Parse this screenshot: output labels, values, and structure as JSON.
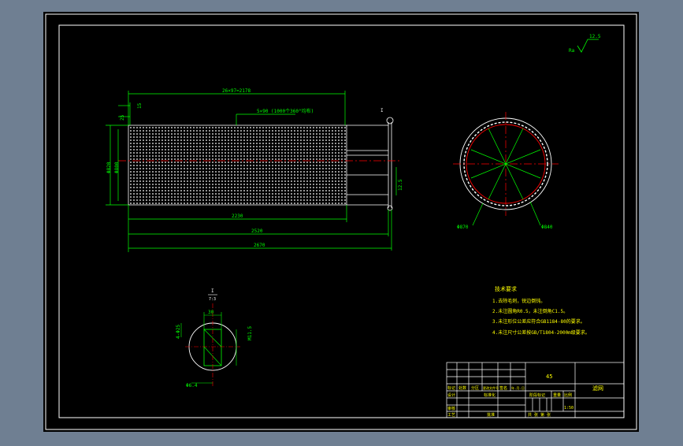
{
  "colors": {
    "background": "#6f7f92",
    "sheet": "#000000",
    "frame": "#ffffff",
    "dimension": "#00ff00",
    "centerline": "#ff0000",
    "note_text": "#ffff00"
  },
  "roughness": {
    "label": "Ra",
    "value": "12.5"
  },
  "main_view": {
    "dims": {
      "top_pattern": "26×97=2178",
      "pitch": "5×90 (1000个360°均布)",
      "left_a": "25",
      "left_b": "15",
      "outer_dia": "Φ820",
      "inner_dia": "Φ800",
      "len_perforated": "2230",
      "len_mid": "2520",
      "len_total": "2670",
      "end_thk": "12.5",
      "section_label": "I"
    }
  },
  "end_view": {
    "dims": {
      "left": "Φ870",
      "right": "Φ840"
    }
  },
  "detail_view": {
    "label": "I",
    "scale": "7:3",
    "dims": {
      "top": "30",
      "left": "4-Φ25",
      "right": "M11.5",
      "bottom": "Φ6.4"
    }
  },
  "tech_notes": {
    "title": "技术要求",
    "items": [
      "1.去除毛刺，锐边倒钝。",
      "2.未注圆角R0.5，未注倒角C1.5。",
      "3.未注形位公差应符合GB1184-80的要求。",
      "4.未注尺寸公差按GB/T1804-2000m级要求。"
    ]
  },
  "title_block": {
    "material": "45",
    "drawing_name": "滤网",
    "row_labels": [
      "标记",
      "处数",
      "分区",
      "更改文件号",
      "签名",
      "年.月.日"
    ],
    "designer": "设计",
    "standardize": "标准化",
    "stage": "阶段标记",
    "weight": "重量",
    "scale_label": "比例",
    "scale_value": "1:50",
    "sheets": "共 张 第 张",
    "review": "审核",
    "process": "工艺",
    "approve": "批准"
  }
}
